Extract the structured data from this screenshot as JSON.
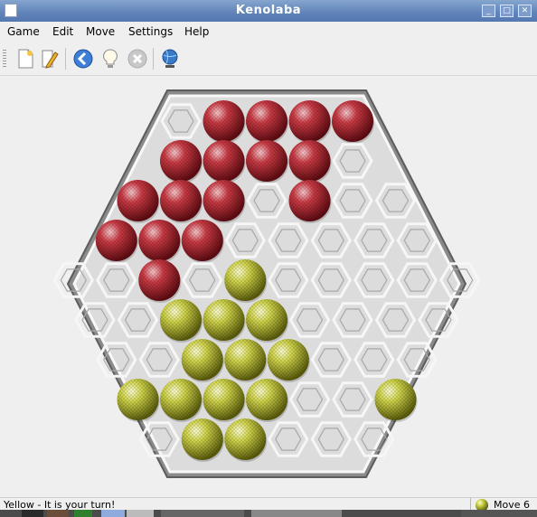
{
  "window": {
    "title": "Kenolaba",
    "minimize_label": "_",
    "maximize_label": "□",
    "close_label": "✕"
  },
  "menubar": {
    "items": [
      {
        "label": "Game"
      },
      {
        "label": "Edit"
      },
      {
        "label": "Move"
      },
      {
        "label": "Settings"
      },
      {
        "label": "Help"
      }
    ]
  },
  "toolbar": {
    "icons": [
      "new-game-icon",
      "edit-icon",
      "undo-back-icon",
      "hint-lightbulb-icon",
      "stop-icon",
      "network-globe-icon"
    ]
  },
  "board": {
    "colors": {
      "red_piece": "#b8252e",
      "yellow_piece": "#c8cc3a",
      "board": "#dcdcdc",
      "frame": "#8a8a8a"
    },
    "rows": [
      ".RRRR",
      "RRRR.",
      "RRR.R..",
      "RRR.....",
      "..R.Y.....",
      "..YYY....",
      "..YYY...",
      "YYYY..Y",
      ".YY..."
    ]
  },
  "status": {
    "text": "Yellow - It is your turn!",
    "move": "Move 6"
  },
  "colors": {
    "title_bar": "#5f83b9",
    "background": "#efefef"
  }
}
